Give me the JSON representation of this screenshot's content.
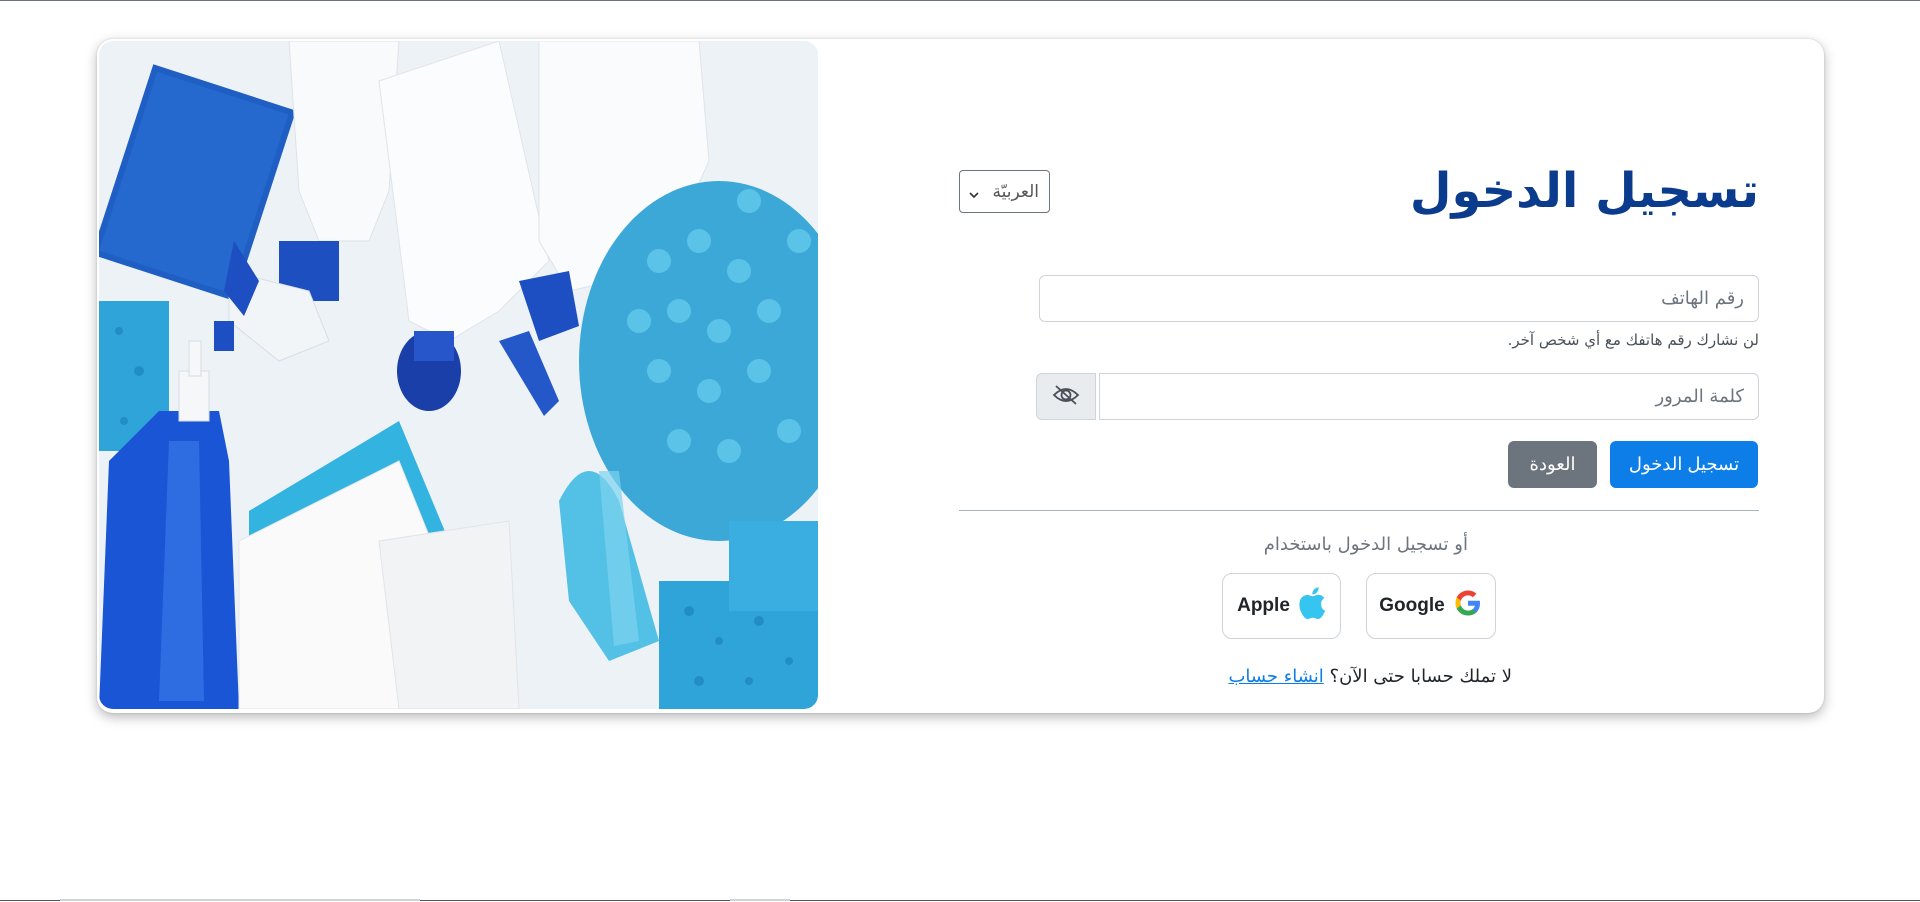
{
  "header": {
    "title": "تسجيل الدخول"
  },
  "language_select": {
    "selected": "العربيّة",
    "icon": "chevron-down-icon"
  },
  "phone": {
    "placeholder": "رقم الهاتف",
    "hint": "لن نشارك رقم هاتفك مع أي شخص آخر."
  },
  "password": {
    "placeholder": "كلمة المرور",
    "toggle_icon": "eye-slash-icon"
  },
  "actions": {
    "login_label": "تسجيل الدخول",
    "back_label": "العودة"
  },
  "social": {
    "prompt": "أو تسجيل الدخول باستخدام",
    "google_label": "Google",
    "apple_label": "Apple"
  },
  "signup": {
    "question": "لا تملك حسابا حتى الآن؟",
    "link_label": "انشاء حساب"
  },
  "colors": {
    "title": "#0b3b8c",
    "primary": "#0d7ee8",
    "secondary": "#6c757d",
    "apple_icon": "#35c5f0"
  }
}
